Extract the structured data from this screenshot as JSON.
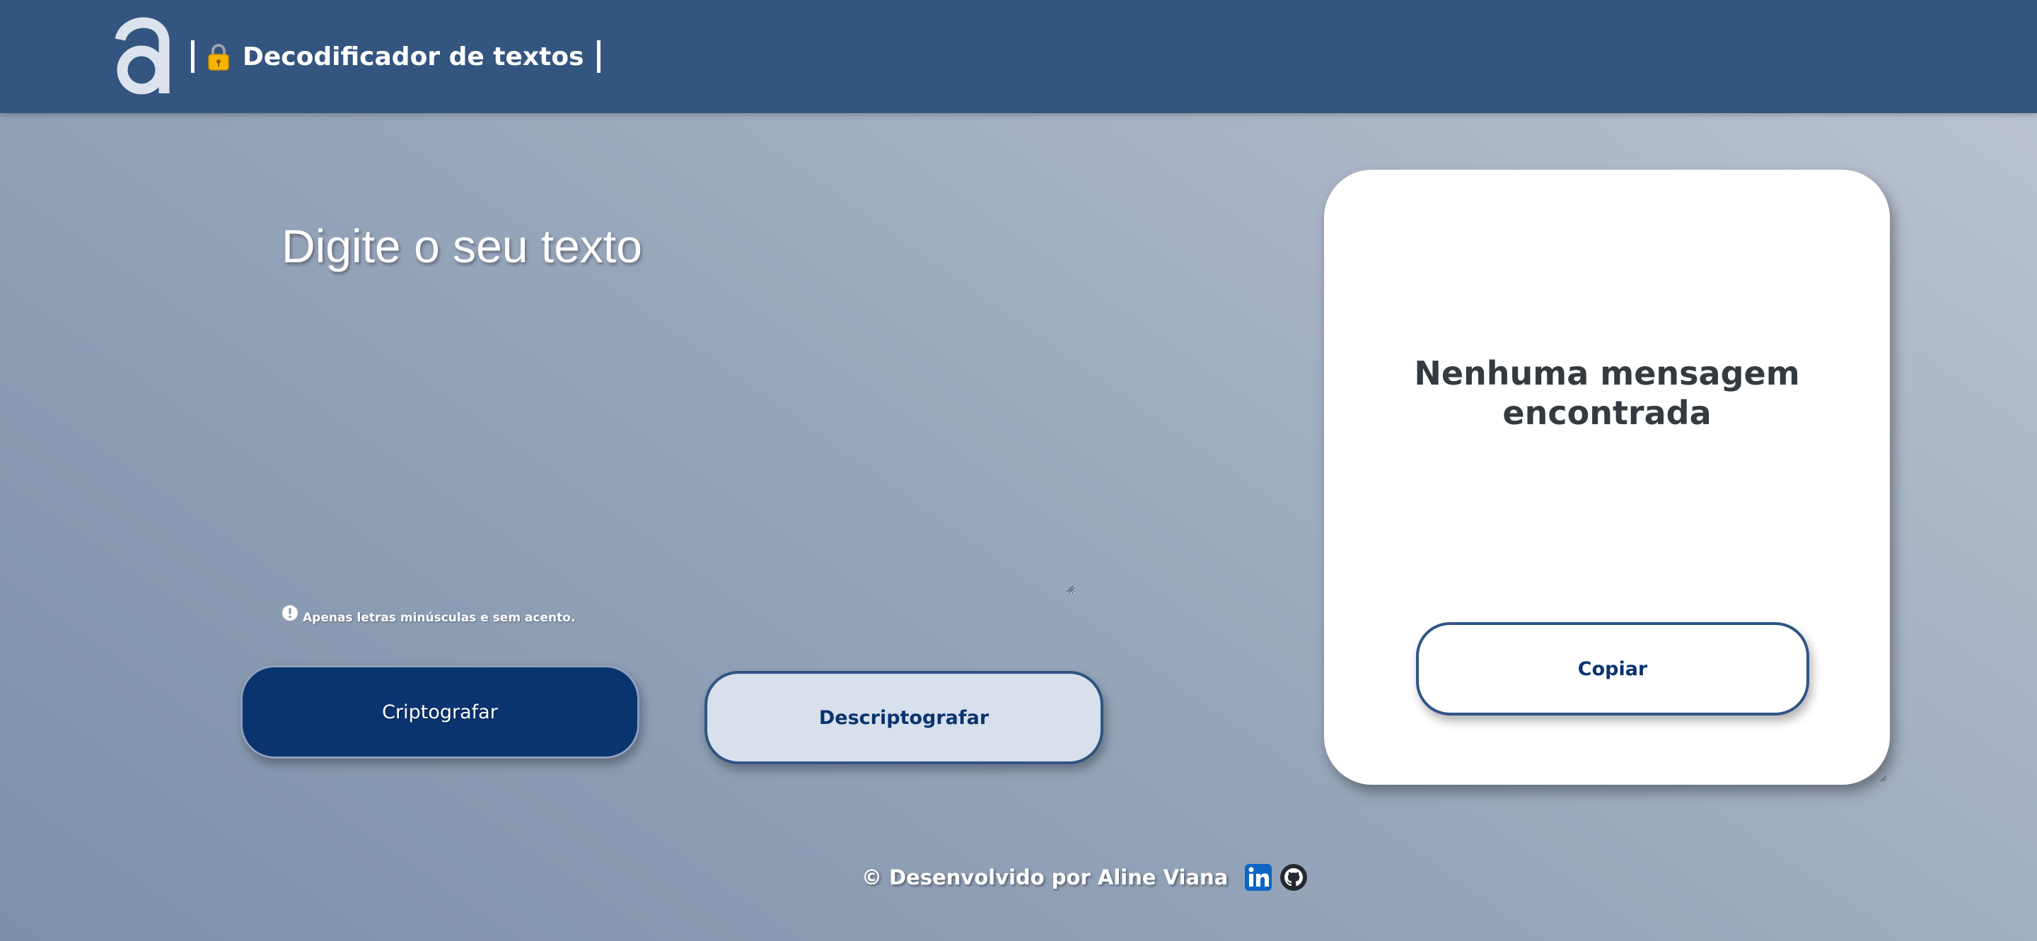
{
  "header": {
    "logo_icon": "letter-a-logo-icon",
    "lock_icon": "lock-icon",
    "title": "Decodificador de textos"
  },
  "input": {
    "placeholder": "Digite o seu texto",
    "value": ""
  },
  "hint": {
    "icon": "info-icon",
    "text": "Apenas letras minúsculas e sem acento."
  },
  "buttons": {
    "encrypt_label": "Criptografar",
    "decrypt_label": "Descriptografar"
  },
  "output": {
    "empty_message": "Nenhuma mensagem encontrada",
    "copy_label": "Copiar"
  },
  "footer": {
    "text": "© Desenvolvido por Aline Viana",
    "links": [
      "linkedin-icon",
      "github-icon"
    ]
  },
  "colors": {
    "header_bg": "#33557f",
    "primary": "#0a3470",
    "secondary_bg": "#d8e0ec",
    "card_bg": "#ffffff",
    "text_dark": "#343a40"
  }
}
